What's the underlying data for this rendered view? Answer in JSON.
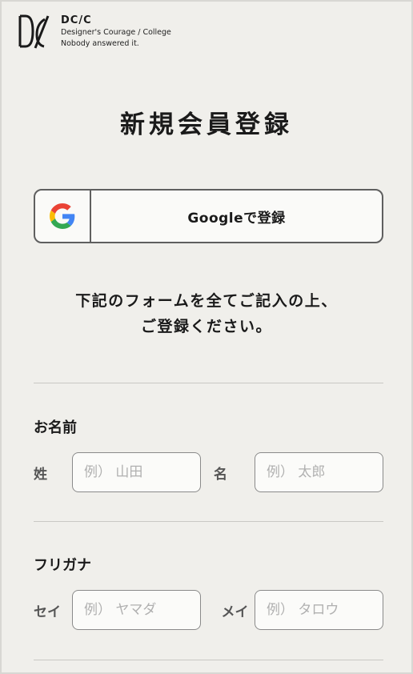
{
  "brand": {
    "name": "DC/C",
    "tagline1": "Designer's Courage / College",
    "tagline2": "Nobody answered it."
  },
  "page_title": "新規会員登録",
  "google_button": {
    "label": "Googleで登録",
    "icon": "google-g-icon"
  },
  "instructions": {
    "line1": "下記のフォームを全てご記入の上、",
    "line2": "ご登録ください。"
  },
  "name_section": {
    "title": "お名前",
    "last_label": "姓",
    "last_placeholder": "例） 山田",
    "first_label": "名",
    "first_placeholder": "例） 太郎"
  },
  "kana_section": {
    "title": "フリガナ",
    "last_label": "セイ",
    "last_placeholder": "例） ヤマダ",
    "first_label": "メイ",
    "first_placeholder": "例） タロウ"
  },
  "colors": {
    "background": "#f0efeb",
    "text": "#1a1a1a",
    "border": "#5f5f5f",
    "google_blue": "#4285F4",
    "google_red": "#EA4335",
    "google_yellow": "#FBBC05",
    "google_green": "#34A853"
  }
}
